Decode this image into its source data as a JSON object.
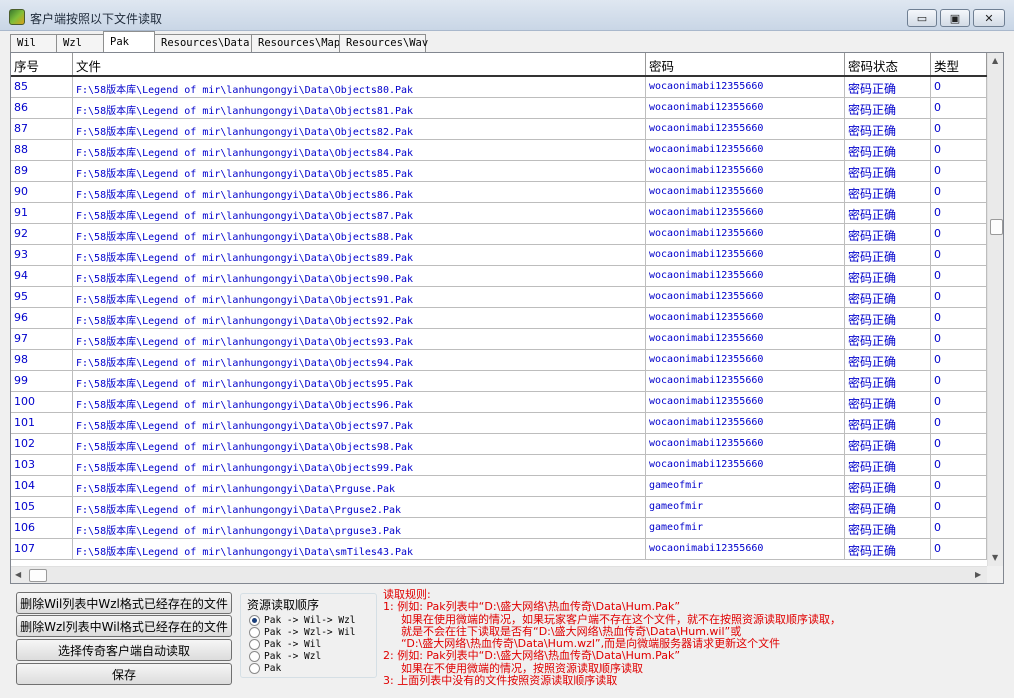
{
  "window": {
    "title": "客户端按照以下文件读取",
    "min_glyph": "▭",
    "max_glyph": "▣",
    "close_glyph": "✕"
  },
  "tabs": [
    {
      "label": "Wil",
      "active": false
    },
    {
      "label": "Wzl",
      "active": false
    },
    {
      "label": "Pak",
      "active": true
    },
    {
      "label": "Resources\\Data",
      "active": false
    },
    {
      "label": "Resources\\Map",
      "active": false
    },
    {
      "label": "Resources\\Wav",
      "active": false
    }
  ],
  "table": {
    "headers": [
      "序号",
      "文件",
      "密码",
      "密码状态",
      "类型"
    ],
    "rows": [
      [
        "85",
        "F:\\58版本库\\Legend of mir\\lanhungongyi\\Data\\Objects80.Pak",
        "wocaonimabi12355660",
        "密码正确",
        "0"
      ],
      [
        "86",
        "F:\\58版本库\\Legend of mir\\lanhungongyi\\Data\\Objects81.Pak",
        "wocaonimabi12355660",
        "密码正确",
        "0"
      ],
      [
        "87",
        "F:\\58版本库\\Legend of mir\\lanhungongyi\\Data\\Objects82.Pak",
        "wocaonimabi12355660",
        "密码正确",
        "0"
      ],
      [
        "88",
        "F:\\58版本库\\Legend of mir\\lanhungongyi\\Data\\Objects84.Pak",
        "wocaonimabi12355660",
        "密码正确",
        "0"
      ],
      [
        "89",
        "F:\\58版本库\\Legend of mir\\lanhungongyi\\Data\\Objects85.Pak",
        "wocaonimabi12355660",
        "密码正确",
        "0"
      ],
      [
        "90",
        "F:\\58版本库\\Legend of mir\\lanhungongyi\\Data\\Objects86.Pak",
        "wocaonimabi12355660",
        "密码正确",
        "0"
      ],
      [
        "91",
        "F:\\58版本库\\Legend of mir\\lanhungongyi\\Data\\Objects87.Pak",
        "wocaonimabi12355660",
        "密码正确",
        "0"
      ],
      [
        "92",
        "F:\\58版本库\\Legend of mir\\lanhungongyi\\Data\\Objects88.Pak",
        "wocaonimabi12355660",
        "密码正确",
        "0"
      ],
      [
        "93",
        "F:\\58版本库\\Legend of mir\\lanhungongyi\\Data\\Objects89.Pak",
        "wocaonimabi12355660",
        "密码正确",
        "0"
      ],
      [
        "94",
        "F:\\58版本库\\Legend of mir\\lanhungongyi\\Data\\Objects90.Pak",
        "wocaonimabi12355660",
        "密码正确",
        "0"
      ],
      [
        "95",
        "F:\\58版本库\\Legend of mir\\lanhungongyi\\Data\\Objects91.Pak",
        "wocaonimabi12355660",
        "密码正确",
        "0"
      ],
      [
        "96",
        "F:\\58版本库\\Legend of mir\\lanhungongyi\\Data\\Objects92.Pak",
        "wocaonimabi12355660",
        "密码正确",
        "0"
      ],
      [
        "97",
        "F:\\58版本库\\Legend of mir\\lanhungongyi\\Data\\Objects93.Pak",
        "wocaonimabi12355660",
        "密码正确",
        "0"
      ],
      [
        "98",
        "F:\\58版本库\\Legend of mir\\lanhungongyi\\Data\\Objects94.Pak",
        "wocaonimabi12355660",
        "密码正确",
        "0"
      ],
      [
        "99",
        "F:\\58版本库\\Legend of mir\\lanhungongyi\\Data\\Objects95.Pak",
        "wocaonimabi12355660",
        "密码正确",
        "0"
      ],
      [
        "100",
        "F:\\58版本库\\Legend of mir\\lanhungongyi\\Data\\Objects96.Pak",
        "wocaonimabi12355660",
        "密码正确",
        "0"
      ],
      [
        "101",
        "F:\\58版本库\\Legend of mir\\lanhungongyi\\Data\\Objects97.Pak",
        "wocaonimabi12355660",
        "密码正确",
        "0"
      ],
      [
        "102",
        "F:\\58版本库\\Legend of mir\\lanhungongyi\\Data\\Objects98.Pak",
        "wocaonimabi12355660",
        "密码正确",
        "0"
      ],
      [
        "103",
        "F:\\58版本库\\Legend of mir\\lanhungongyi\\Data\\Objects99.Pak",
        "wocaonimabi12355660",
        "密码正确",
        "0"
      ],
      [
        "104",
        "F:\\58版本库\\Legend of mir\\lanhungongyi\\Data\\Prguse.Pak",
        "gameofmir",
        "密码正确",
        "0"
      ],
      [
        "105",
        "F:\\58版本库\\Legend of mir\\lanhungongyi\\Data\\Prguse2.Pak",
        "gameofmir",
        "密码正确",
        "0"
      ],
      [
        "106",
        "F:\\58版本库\\Legend of mir\\lanhungongyi\\Data\\prguse3.Pak",
        "gameofmir",
        "密码正确",
        "0"
      ],
      [
        "107",
        "F:\\58版本库\\Legend of mir\\lanhungongyi\\Data\\smTiles43.Pak",
        "wocaonimabi12355660",
        "密码正确",
        "0"
      ]
    ]
  },
  "buttons": {
    "delete_wil": "删除Wil列表中Wzl格式已经存在的文件",
    "delete_wzl": "删除Wzl列表中Wil格式已经存在的文件",
    "select_auto": "选择传奇客户端自动读取",
    "save": "保存"
  },
  "read_order": {
    "title": "资源读取顺序",
    "options": [
      {
        "label": "Pak -> Wil-> Wzl",
        "checked": true
      },
      {
        "label": "Pak -> Wzl-> Wil",
        "checked": false
      },
      {
        "label": "Pak -> Wil",
        "checked": false
      },
      {
        "label": "Pak -> Wzl",
        "checked": false
      },
      {
        "label": "Pak",
        "checked": false
      }
    ]
  },
  "rules": {
    "lines": [
      "读取规则:",
      "1: 例如: Pak列表中“D:\\盛大网络\\热血传奇\\Data\\Hum.Pak”",
      "如果在使用微端的情况，如果玩家客户端不存在这个文件，就不在按照资源读取顺序读取，",
      "就是不会在往下读取是否有“D:\\盛大网络\\热血传奇\\Data\\Hum.wil”或",
      "“D:\\盛大网络\\热血传奇\\Data\\Hum.wzl”,而是向微端服务器请求更新这个文件",
      "2: 例如: Pak列表中“D:\\盛大网络\\热血传奇\\Data\\Hum.Pak”",
      "如果在不使用微端的情况，按照资源读取顺序读取",
      "3: 上面列表中没有的文件按照资源读取顺序读取"
    ]
  }
}
